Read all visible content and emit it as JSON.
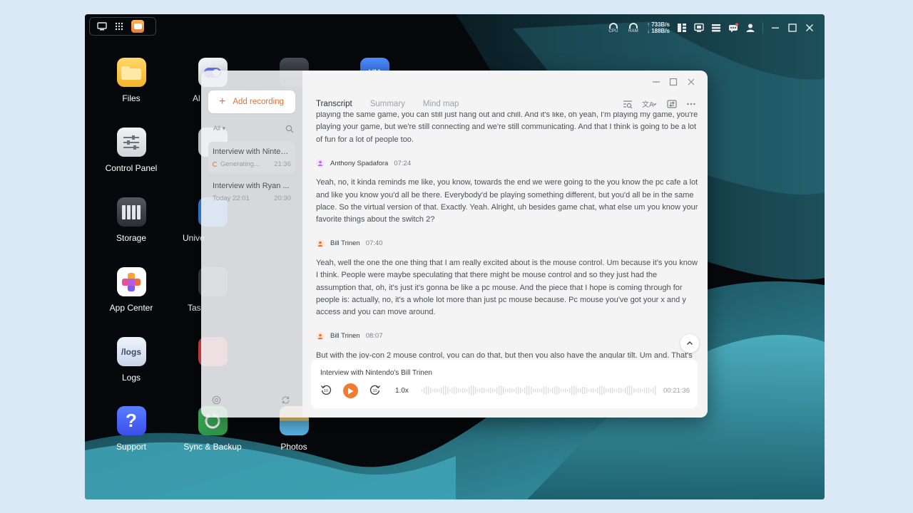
{
  "colors": {
    "accent": "#ee6b2b",
    "wallpaper_teal": "#3a9fb1",
    "screen_bg": "#07090c"
  },
  "system_bar": {
    "cpu_label": "CPU",
    "ram_label": "RAM",
    "upload_rate": "↑ 733B/s",
    "download_rate": "↓ 188B/s"
  },
  "desktop": {
    "icons": [
      {
        "label": "Files",
        "icon": "folder-icon"
      },
      {
        "label": "Al",
        "icon": "ai-icon"
      },
      {
        "label": "Control Panel",
        "icon": "sliders-icon"
      },
      {
        "label": "Storage",
        "icon": "storage-icon"
      },
      {
        "label": "Unive",
        "icon": "universe-icon"
      },
      {
        "label": "App Center",
        "icon": "app-center-icon"
      },
      {
        "label": "Tas",
        "icon": "task-icon"
      },
      {
        "label": "Logs",
        "icon": "logs-icon",
        "glyph": "/logs"
      },
      {
        "label": "Support",
        "icon": "support-icon",
        "glyph": "?"
      },
      {
        "label": "Sync & Backup",
        "icon": "sync-icon"
      },
      {
        "label": "Photos",
        "icon": "photos-icon"
      },
      {
        "label": "",
        "icon": "video-icon"
      },
      {
        "label": "",
        "icon": "vm-icon",
        "glyph": "VM"
      }
    ]
  },
  "sidebar": {
    "add_button_label": "Add recording",
    "filter_label": "All ▾",
    "recordings": [
      {
        "title": "Interview with Nintendo's Bill Trinen",
        "status": "Generating...",
        "duration": "21:36"
      },
      {
        "title": "Interview with Ryan ...",
        "status": "Today 22:01",
        "duration": "20:30"
      }
    ]
  },
  "main": {
    "tabs": [
      "Transcript",
      "Summary",
      "Mind map"
    ],
    "transcript": {
      "partial_top": "playing the same game, you can still just hang out and chill. And it's like, oh yeah, I'm playing my game, you're playing your game, but we're still connecting and we're still communicating. And that I think is going to be a lot of fun for a lot of people too.",
      "segments": [
        {
          "speaker": "Anthony Spadafora",
          "time": "07:24",
          "color": "#b06fe0",
          "text": "Yeah, no, it kinda reminds me like, you know, towards the end we were going to the you know the pc cafe a lot and like you know you'd all be there. Everybody'd be playing something different, but you'd all be in the same place. So the virtual version of that. Exactly. Yeah. Alright, uh besides game chat, what else um you know your favorite things about the switch 2?"
        },
        {
          "speaker": "Bill Trinen",
          "time": "07:40",
          "color": "#ee6b2b",
          "text": "Yeah, well the one the one thing that I am really excited about is the mouse control. Um because it's you know I think. People were maybe speculating that there might be mouse control and so they just had the assumption that, oh, it's just it's gonna be like a pc mouse. And the piece that I hope is coming through for people is: actually, no, it's a whole lot more than just pc mouse because. Pc mouse you've got your x and y access and you can move around."
        },
        {
          "speaker": "Bill Trinen",
          "time": "08:07",
          "color": "#ee6b2b",
          "text": "But with the joy-con 2 mouse control, you can do that, but then you also have the angular tilt. Um and. That's"
        }
      ]
    }
  },
  "player": {
    "title": "Interview with Nintendo's Bill Trinen",
    "speed": "1.0x",
    "duration": "00:21:36",
    "rewind_seconds": "10",
    "forward_seconds": "10"
  }
}
